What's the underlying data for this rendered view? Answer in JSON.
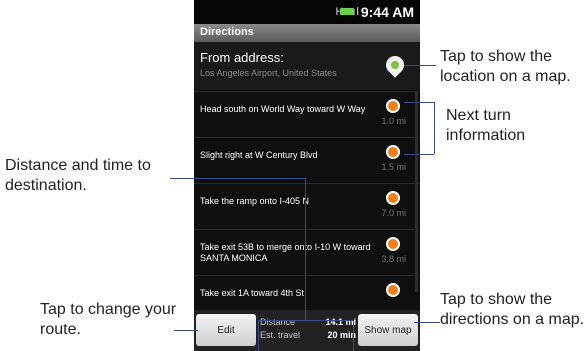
{
  "phone": {
    "status": {
      "time": "9:44 AM",
      "icons": "H  .ıl"
    },
    "title": "Directions",
    "from": {
      "title": "From address:",
      "subtitle": "Los Angeles Airport, United States"
    },
    "steps": [
      {
        "text": "Head south on World Way toward W Way",
        "distance": "1.0 mi"
      },
      {
        "text": "Slight right at W Century Blvd",
        "distance": "1.5 mi"
      },
      {
        "text": "Take the ramp onto I-405 N",
        "distance": "7.0 mi"
      },
      {
        "text": "Take exit 53B to merge onto I-10 W toward SANTA MONICA",
        "distance": "3.8 mi"
      },
      {
        "text": "Take exit 1A toward 4th St",
        "distance": ""
      }
    ],
    "bottom": {
      "edit_label": "Edit",
      "show_map_label": "Show map",
      "distance_label": "Distance",
      "distance_value": "14.1 mi",
      "time_label": "Est. travel",
      "time_value": "20 min"
    }
  },
  "callouts": {
    "show_location": "Tap to show the location on a map.",
    "next_turn": "Next turn information",
    "distance_time": "Distance and time to destination.",
    "change_route": "Tap to change your route.",
    "show_directions": "Tap to show the directions on a map."
  }
}
